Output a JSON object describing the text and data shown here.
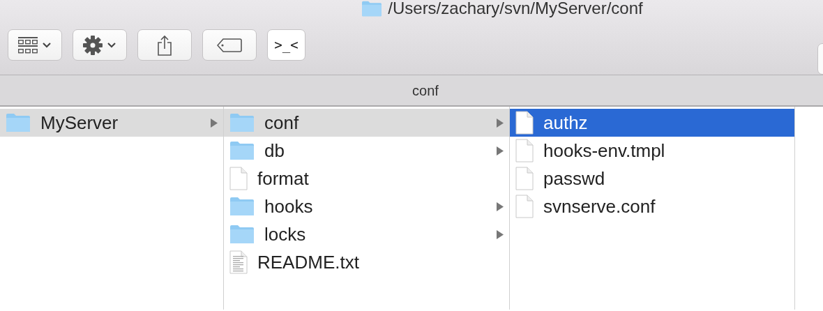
{
  "window": {
    "title": "/Users/zachary/svn/MyServer/conf"
  },
  "toolbar": [
    {
      "kind": "view"
    },
    {
      "kind": "action"
    },
    {
      "kind": "share"
    },
    {
      "kind": "tag"
    },
    {
      "kind": "terminal",
      "label": ">_<"
    }
  ],
  "path_bar": {
    "label": "conf"
  },
  "columns": [
    {
      "active": false,
      "items": [
        {
          "name": "MyServer",
          "kind": "folder",
          "selected": true
        }
      ]
    },
    {
      "active": false,
      "items": [
        {
          "name": "conf",
          "kind": "folder",
          "selected": true
        },
        {
          "name": "db",
          "kind": "folder",
          "selected": false
        },
        {
          "name": "format",
          "kind": "file",
          "selected": false
        },
        {
          "name": "hooks",
          "kind": "folder",
          "selected": false
        },
        {
          "name": "locks",
          "kind": "folder",
          "selected": false
        },
        {
          "name": "README.txt",
          "kind": "text",
          "selected": false
        }
      ]
    },
    {
      "active": true,
      "items": [
        {
          "name": "authz",
          "kind": "file",
          "selected": true
        },
        {
          "name": "hooks-env.tmpl",
          "kind": "file",
          "selected": false
        },
        {
          "name": "passwd",
          "kind": "file",
          "selected": false
        },
        {
          "name": "svnserve.conf",
          "kind": "file",
          "selected": false
        }
      ]
    }
  ]
}
